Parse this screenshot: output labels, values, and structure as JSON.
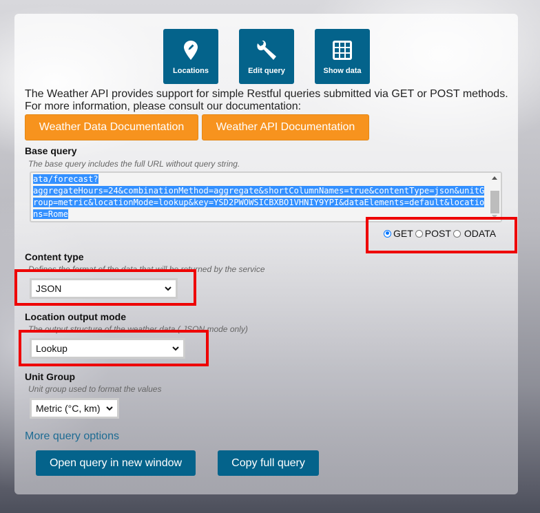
{
  "toolbar": {
    "buttons": [
      {
        "label": "Locations",
        "icon": "map-pin-edit-icon"
      },
      {
        "label": "Edit query",
        "icon": "wrench-icon"
      },
      {
        "label": "Show data",
        "icon": "grid-icon"
      }
    ]
  },
  "intro": {
    "line1": "The Weather API provides support for simple Restful queries submitted via GET or POST methods.",
    "line2": "For more information, please consult our documentation:"
  },
  "docs": {
    "weather_data_label": "Weather Data Documentation",
    "weather_api_label": "Weather API Documentation"
  },
  "base_query": {
    "label": "Base query",
    "hint": "The base query includes the full URL without query string.",
    "value": "ata/forecast?\naggregateHours=24&combinationMethod=aggregate&shortColumnNames=true&contentType=json&unitGroup=metric&locationMode=lookup&key=YSD2PWOWSICBXBO1VHNIY9YPI&dataElements=default&locations=Rome",
    "methods": [
      {
        "label": "GET",
        "selected": true
      },
      {
        "label": "POST",
        "selected": false
      },
      {
        "label": "ODATA",
        "selected": false
      }
    ]
  },
  "content_type": {
    "label": "Content type",
    "hint": "Defines the format of the data that will be returned by the service",
    "selected": "JSON"
  },
  "location_mode": {
    "label": "Location output mode",
    "hint": "The output structure of the weather data ( JSON mode only)",
    "selected": "Lookup"
  },
  "unit_group": {
    "label": "Unit Group",
    "hint": "Unit group used to format the values",
    "selected": "Metric (°C, km)"
  },
  "more_options_label": "More query options",
  "actions": {
    "open_label": "Open query in new window",
    "copy_label": "Copy full query"
  },
  "colors": {
    "primary": "#04638b",
    "accent": "#f7931e",
    "highlight": "#ee0000",
    "selection": "#3390ff"
  }
}
